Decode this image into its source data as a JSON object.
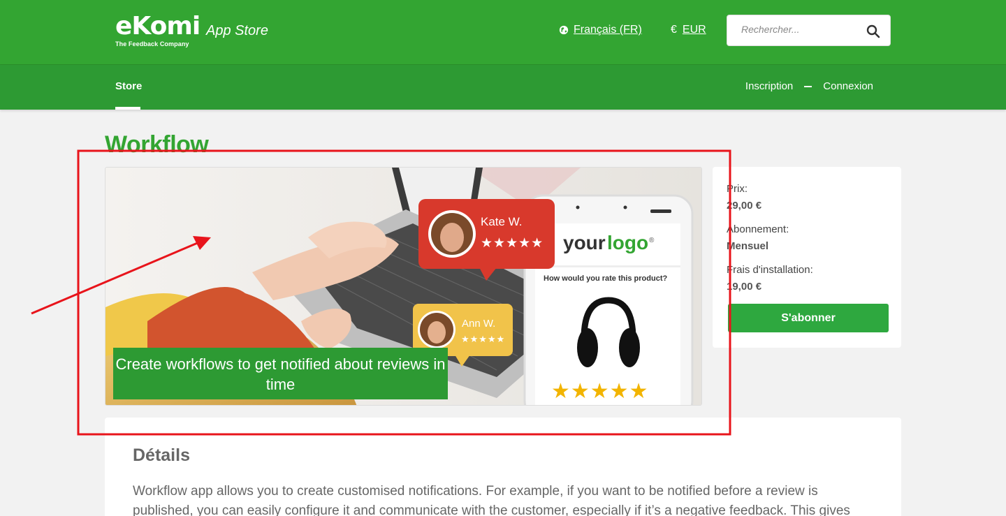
{
  "header": {
    "logo_text": "eKomi",
    "logo_tagline": "The Feedback Company",
    "app_store_label": "App Store",
    "language": "Français (FR)",
    "currency_symbol": "€",
    "currency": "EUR",
    "search_placeholder": "Rechercher..."
  },
  "nav": {
    "store": "Store",
    "register": "Inscription",
    "login": "Connexion"
  },
  "page": {
    "title": "Workflow"
  },
  "hero": {
    "caption": "Create workflows to get notified about reviews in time",
    "review1_name": "Kate W.",
    "review2_name": "Ann W.",
    "stars1": "★★★★★",
    "stars2": "★★★★★",
    "phone_logo_your": "your",
    "phone_logo_logo": "logo",
    "phone_logo_mark": "®",
    "phone_question": "How would you rate this product?",
    "phone_stars": "★★★★★"
  },
  "pricing": {
    "price_label": "Prix:",
    "price_value": "29,00 €",
    "subscription_label": "Abonnement:",
    "subscription_value": "Mensuel",
    "setup_label": "Frais d'installation:",
    "setup_value": "19,00 €",
    "subscribe_button": "S'abonner"
  },
  "details": {
    "heading": "Détails",
    "text": "Workflow app allows you to create customised notifications. For example, if you want to be notified before a review is published, you can easily configure it and communicate with the customer, especially if it’s a negative feedback. This gives"
  },
  "colors": {
    "brand_green": "#33a532",
    "nav_green": "#2d9a33",
    "annotation_red": "#e8141b"
  }
}
